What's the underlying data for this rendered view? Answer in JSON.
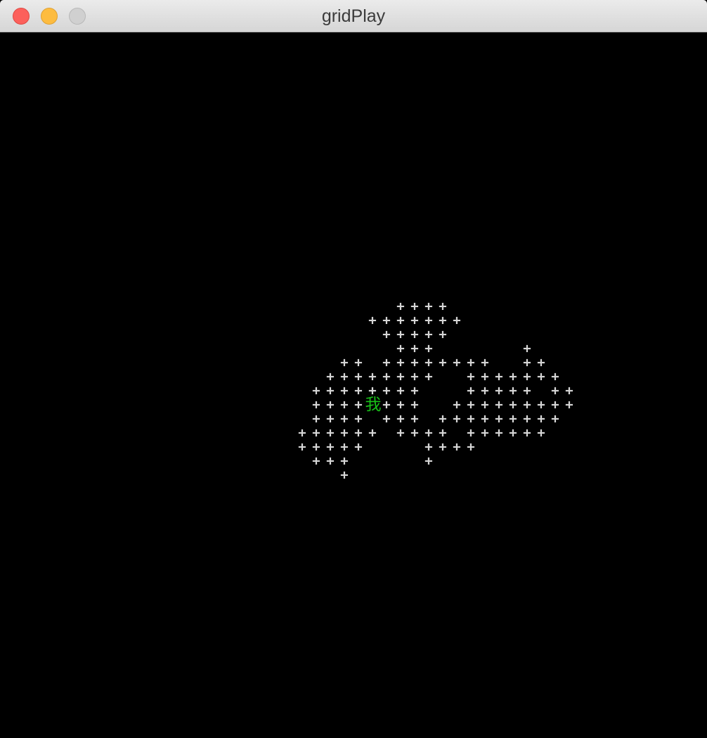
{
  "window": {
    "title": "gridPlay"
  },
  "colors": {
    "background": "#000000",
    "tile": "#d6d6d6",
    "player": "#18c018"
  },
  "game": {
    "tile_char": "+",
    "player_char": "我",
    "player_cell": [
      26,
      26
    ],
    "grid_rows": [
      {
        "row": 19,
        "cols": [
          28,
          29,
          30,
          31
        ]
      },
      {
        "row": 20,
        "cols": [
          26,
          27,
          28,
          29,
          30,
          31,
          32
        ]
      },
      {
        "row": 21,
        "cols": [
          27,
          28,
          29,
          30,
          31
        ]
      },
      {
        "row": 22,
        "cols": [
          28,
          29,
          30,
          37
        ]
      },
      {
        "row": 23,
        "cols": [
          24,
          25,
          27,
          28,
          29,
          30,
          31,
          32,
          33,
          34,
          37,
          38
        ]
      },
      {
        "row": 24,
        "cols": [
          23,
          24,
          25,
          26,
          27,
          28,
          29,
          30,
          33,
          34,
          35,
          36,
          37,
          38,
          39
        ]
      },
      {
        "row": 25,
        "cols": [
          22,
          23,
          24,
          25,
          26,
          27,
          28,
          29,
          33,
          34,
          35,
          36,
          37,
          39,
          40
        ]
      },
      {
        "row": 26,
        "cols": [
          22,
          23,
          24,
          25,
          27,
          28,
          29,
          32,
          33,
          34,
          35,
          36,
          37,
          38,
          39,
          40
        ]
      },
      {
        "row": 27,
        "cols": [
          22,
          23,
          24,
          25,
          27,
          28,
          29,
          31,
          32,
          33,
          34,
          35,
          36,
          37,
          38,
          39
        ]
      },
      {
        "row": 28,
        "cols": [
          21,
          22,
          23,
          24,
          25,
          26,
          28,
          29,
          30,
          31,
          33,
          34,
          35,
          36,
          37,
          38
        ]
      },
      {
        "row": 29,
        "cols": [
          21,
          22,
          23,
          24,
          25,
          30,
          31,
          32,
          33
        ]
      },
      {
        "row": 30,
        "cols": [
          22,
          23,
          24,
          30
        ]
      },
      {
        "row": 31,
        "cols": [
          24
        ]
      }
    ]
  }
}
